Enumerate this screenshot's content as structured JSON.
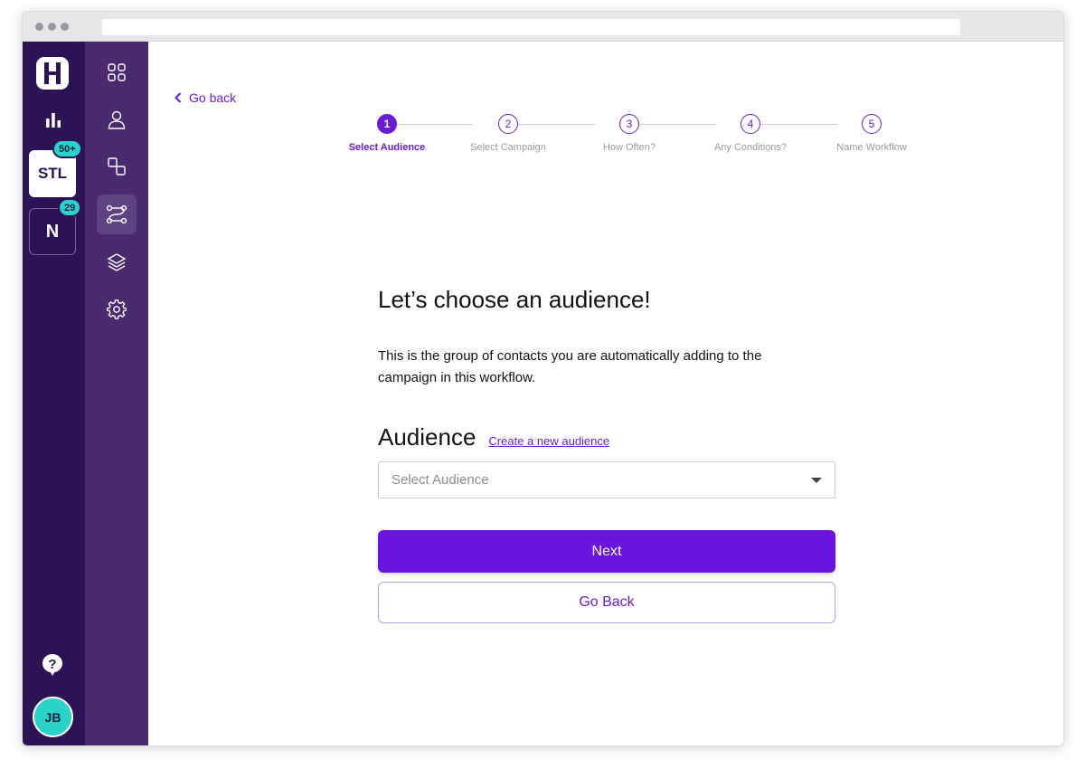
{
  "rail": {
    "workspaces": [
      {
        "label": "STL",
        "badge": "50+",
        "active": true
      },
      {
        "label": "N",
        "badge": "29",
        "active": false
      }
    ],
    "user_initials": "JB"
  },
  "nav": {
    "items": [
      {
        "icon": "grid-icon"
      },
      {
        "icon": "user-icon"
      },
      {
        "icon": "shapes-icon"
      },
      {
        "icon": "workflow-icon",
        "active": true
      },
      {
        "icon": "layers-icon"
      },
      {
        "icon": "gear-icon"
      }
    ]
  },
  "main": {
    "go_back_link": "Go back",
    "steps": [
      {
        "number": "1",
        "label": "Select Audience",
        "current": true
      },
      {
        "number": "2",
        "label": "Select Campaign"
      },
      {
        "number": "3",
        "label": "How Often?"
      },
      {
        "number": "4",
        "label": "Any Conditions?"
      },
      {
        "number": "5",
        "label": "Name Workflow"
      }
    ],
    "heading": "Let’s choose an audience!",
    "description": "This is the group of contacts you are automatically adding to the campaign in this workflow.",
    "audience_title": "Audience",
    "create_audience_link": "Create a new audience",
    "select_placeholder": "Select Audience",
    "next_button": "Next",
    "go_back_button": "Go Back"
  },
  "colors": {
    "accent": "#6a14e0",
    "rail_bg": "#2c1356",
    "nav_bg": "#4a2a6f",
    "badge": "#2ad3c9"
  }
}
